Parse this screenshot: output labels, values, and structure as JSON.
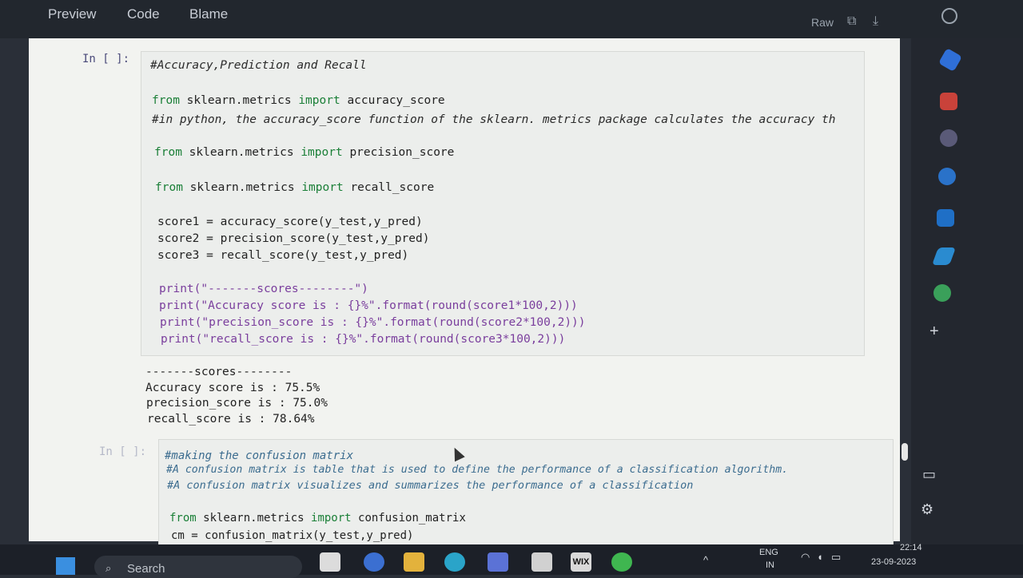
{
  "header": {
    "tabs": [
      "Preview",
      "Code",
      "Blame"
    ],
    "raw_label": "Raw"
  },
  "cell1": {
    "prompt": "In [ ]:",
    "lines": [
      "#Accuracy,Prediction and Recall",
      "from sklearn.metrics import accuracy_score",
      "#in python, the accuracy_score function of the sklearn. metrics package calculates the accuracy th",
      "from sklearn.metrics import precision_score",
      "from sklearn.metrics import recall_score",
      "score1 = accuracy_score(y_test,y_pred)",
      "score2 = precision_score(y_test,y_pred)",
      "score3 = recall_score(y_test,y_pred)",
      "print(\"-------scores--------\")",
      "print(\"Accuracy score is : {}%\".format(round(score1*100,2)))",
      "print(\"precision_score is : {}%\".format(round(score2*100,2)))",
      "print(\"recall_score is : {}%\".format(round(score3*100,2)))"
    ]
  },
  "output1": [
    "-------scores--------",
    "Accuracy score is : 75.5%",
    "precision_score is : 75.0%",
    "recall_score is : 78.64%"
  ],
  "cell2": {
    "prompt": "In [ ]:",
    "lines": [
      "#making the confusion matrix",
      "#A confusion matrix is table that is used to define the performance of a classification algorithm.",
      "#A confusion matrix visualizes and summarizes the performance of a classification",
      "from sklearn.metrics import confusion_matrix",
      "cm = confusion_matrix(y_test,y_pred)"
    ]
  },
  "taskbar": {
    "search_label": "Search",
    "lang_top": "ENG",
    "lang_bottom": "IN",
    "time": "22:14",
    "date": "23-09-2023",
    "wix_label": "WIX"
  }
}
